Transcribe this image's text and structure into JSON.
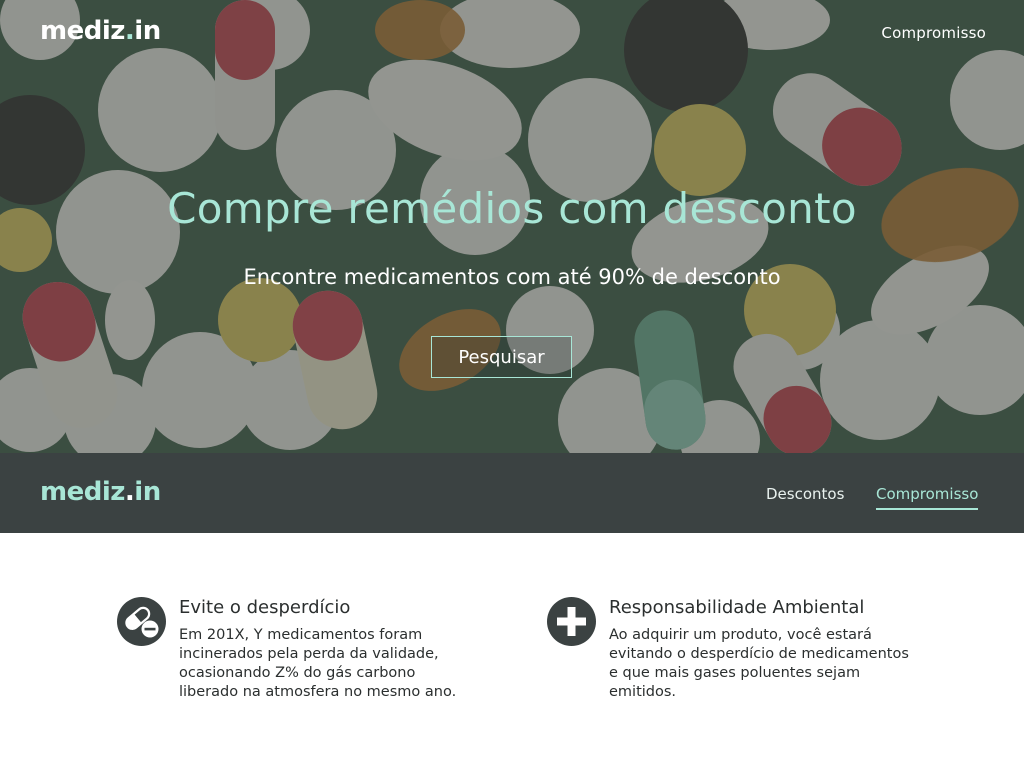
{
  "brand": {
    "name": "mediz",
    "dot": ".",
    "tld": "in"
  },
  "hero": {
    "top_link": "Compromisso",
    "title": "Compre remédios com desconto",
    "subtitle": "Encontre medicamentos com até 90% de desconto",
    "search_button": "Pesquisar"
  },
  "navbar": {
    "links": [
      {
        "label": "Descontos",
        "active": false
      },
      {
        "label": "Compromisso",
        "active": true
      }
    ]
  },
  "features": [
    {
      "icon": "pills-icon",
      "title": "Evite o desperdício",
      "text": "Em 201X, Y medicamentos foram incinerados pela perda da validade, ocasionando Z% do gás carbono liberado na atmosfera no mesmo ano."
    },
    {
      "icon": "plus-icon",
      "title": "Responsabilidade Ambiental",
      "text": "Ao adquirir um produto, você estará evitando o desperdício de medicamentos e que mais gases poluentes sejam emitidos."
    }
  ],
  "colors": {
    "accent": "#a8e6d6",
    "dark": "#3b4242",
    "text": "#2b2f2f",
    "white": "#ffffff"
  }
}
